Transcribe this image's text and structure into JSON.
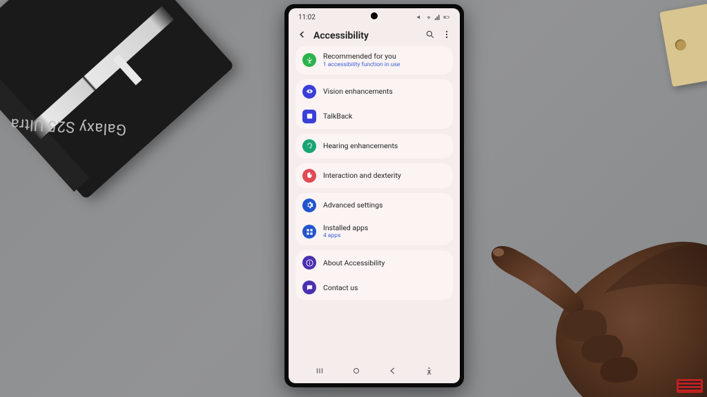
{
  "status": {
    "time": "11:02"
  },
  "header": {
    "title": "Accessibility"
  },
  "rows": {
    "recommended": {
      "label": "Recommended for you",
      "sub": "1 accessibility function in use",
      "color": "#2bb24c"
    },
    "vision": {
      "label": "Vision enhancements",
      "color": "#3a3fd9"
    },
    "talkback": {
      "label": "TalkBack",
      "color": "#3a3fd9"
    },
    "hearing": {
      "label": "Hearing enhancements",
      "color": "#1aa574"
    },
    "interaction": {
      "label": "Interaction and dexterity",
      "color": "#e04a55"
    },
    "advanced": {
      "label": "Advanced settings",
      "color": "#2255cc"
    },
    "installed": {
      "label": "Installed apps",
      "sub": "4 apps",
      "color": "#2255cc"
    },
    "about": {
      "label": "About Accessibility",
      "color": "#4a2fb0"
    },
    "contact": {
      "label": "Contact us",
      "color": "#4a2fb0"
    }
  },
  "box": {
    "label": "Galaxy S25 Ultra"
  }
}
